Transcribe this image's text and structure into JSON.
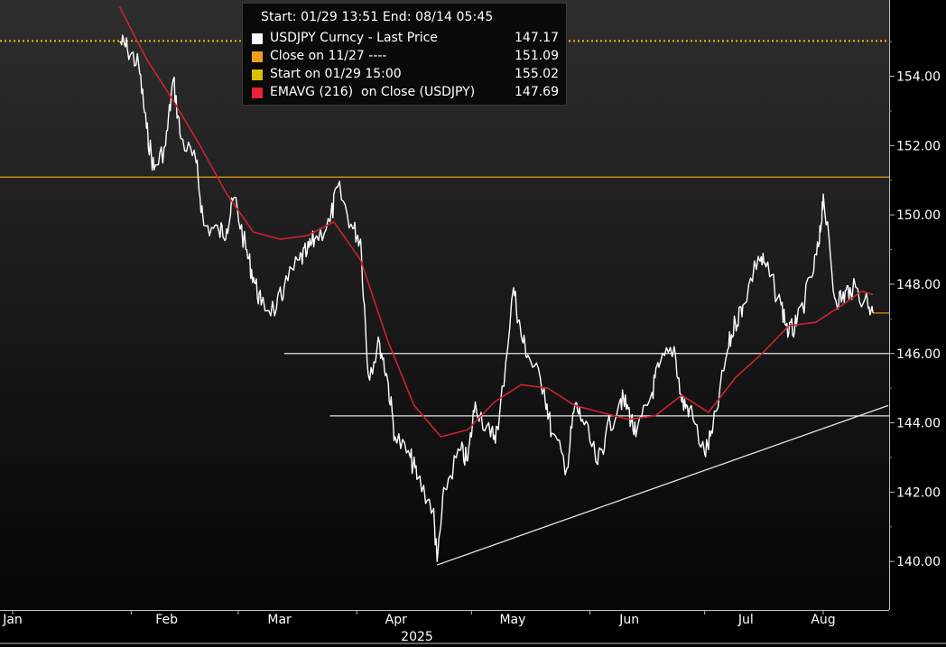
{
  "legend": {
    "header": "Start: 01/29 13:51 End: 08/14 05:45",
    "items": [
      {
        "label": "USDJPY Curncy - Last Price",
        "value": "147.17",
        "color": "#ffffff"
      },
      {
        "label": "Close on 11/27 ----",
        "value": "151.09",
        "color": "#f0a020"
      },
      {
        "label": "Start on 01/29 15:00",
        "value": "155.02",
        "color": "#d8c000"
      },
      {
        "label": "EMAVG (216)  on Close (USDJPY)",
        "value": "147.69",
        "color": "#e8203a"
      }
    ]
  },
  "colors": {
    "background_top": "#2e2e2e",
    "background_bottom": "#050505",
    "price": "#ffffff",
    "ema": "#cc2233",
    "close_line": "#f0a020",
    "start_line": "#e8c000",
    "support_lines": "#e6e6e6"
  },
  "chart_data": {
    "type": "line",
    "title": "",
    "xlabel": "2025",
    "ylabel": "",
    "ylim": [
      138.6,
      156.2
    ],
    "y_ticks": [
      "154.00",
      "152.00",
      "150.00",
      "148.00",
      "146.00",
      "144.00",
      "142.00",
      "140.00"
    ],
    "x_ticks": [
      "Jan",
      "Feb",
      "Mar",
      "Apr",
      "May",
      "Jun",
      "Jul",
      "Aug"
    ],
    "x_range": [
      "2025-01-29",
      "2025-08-18"
    ],
    "grid": false,
    "legend_position": "top-left",
    "series": [
      {
        "name": "USDJPY Curncy - Last Price",
        "dates": [
          "2025-01-29",
          "2025-01-31",
          "2025-02-03",
          "2025-02-05",
          "2025-02-07",
          "2025-02-10",
          "2025-02-12",
          "2025-02-14",
          "2025-02-18",
          "2025-02-20",
          "2025-02-24",
          "2025-02-26",
          "2025-02-28",
          "2025-03-03",
          "2025-03-05",
          "2025-03-07",
          "2025-03-11",
          "2025-03-13",
          "2025-03-17",
          "2025-03-19",
          "2025-03-21",
          "2025-03-25",
          "2025-03-27",
          "2025-03-31",
          "2025-04-02",
          "2025-04-04",
          "2025-04-07",
          "2025-04-09",
          "2025-04-11",
          "2025-04-15",
          "2025-04-17",
          "2025-04-21",
          "2025-04-22",
          "2025-04-24",
          "2025-04-28",
          "2025-04-30",
          "2025-05-02",
          "2025-05-06",
          "2025-05-08",
          "2025-05-12",
          "2025-05-14",
          "2025-05-16",
          "2025-05-20",
          "2025-05-22",
          "2025-05-26",
          "2025-05-28",
          "2025-05-30",
          "2025-06-03",
          "2025-06-05",
          "2025-06-09",
          "2025-06-11",
          "2025-06-13",
          "2025-06-17",
          "2025-06-19",
          "2025-06-23",
          "2025-06-25",
          "2025-06-27",
          "2025-07-01",
          "2025-07-03",
          "2025-07-07",
          "2025-07-09",
          "2025-07-11",
          "2025-07-15",
          "2025-07-17",
          "2025-07-21",
          "2025-07-23",
          "2025-07-25",
          "2025-07-29",
          "2025-07-31",
          "2025-08-01",
          "2025-08-04",
          "2025-08-06",
          "2025-08-08",
          "2025-08-12",
          "2025-08-14"
        ],
        "values": [
          155.0,
          154.8,
          154.3,
          152.5,
          151.3,
          152.0,
          153.9,
          152.2,
          151.5,
          149.7,
          149.5,
          149.6,
          150.5,
          149.0,
          148.2,
          147.4,
          147.3,
          147.9,
          148.7,
          148.9,
          149.3,
          149.8,
          150.8,
          149.6,
          149.3,
          145.4,
          146.3,
          145.3,
          143.6,
          143.0,
          142.4,
          141.5,
          140.0,
          142.1,
          143.2,
          142.9,
          144.6,
          143.6,
          143.8,
          147.9,
          146.5,
          145.9,
          145.0,
          143.7,
          142.7,
          144.5,
          144.1,
          142.8,
          143.6,
          144.7,
          144.4,
          143.6,
          144.8,
          145.6,
          146.2,
          144.6,
          144.4,
          143.1,
          143.7,
          146.1,
          146.9,
          147.4,
          148.8,
          148.5,
          147.4,
          146.6,
          146.8,
          148.2,
          149.2,
          150.6,
          147.6,
          147.6,
          147.9,
          147.6,
          147.17
        ]
      },
      {
        "name": "EMAVG (216)  on Close (USDJPY)",
        "dates": [
          "2025-01-29",
          "2025-02-05",
          "2025-02-12",
          "2025-02-19",
          "2025-02-26",
          "2025-03-05",
          "2025-03-12",
          "2025-03-19",
          "2025-03-26",
          "2025-04-02",
          "2025-04-09",
          "2025-04-16",
          "2025-04-23",
          "2025-04-30",
          "2025-05-07",
          "2025-05-14",
          "2025-05-21",
          "2025-05-28",
          "2025-06-04",
          "2025-06-11",
          "2025-06-18",
          "2025-06-25",
          "2025-07-02",
          "2025-07-09",
          "2025-07-16",
          "2025-07-23",
          "2025-07-30",
          "2025-08-06",
          "2025-08-11",
          "2025-08-14"
        ],
        "values": [
          156.0,
          154.5,
          153.3,
          152.0,
          150.6,
          149.5,
          149.3,
          149.4,
          149.8,
          148.7,
          146.4,
          144.5,
          143.6,
          143.8,
          144.6,
          145.1,
          145.0,
          144.5,
          144.3,
          144.1,
          144.2,
          144.8,
          144.3,
          145.3,
          146.0,
          146.8,
          146.9,
          147.4,
          147.8,
          147.7
        ]
      }
    ],
    "reference_lines": [
      {
        "name": "Close on 11/27",
        "value": 151.09
      },
      {
        "name": "Start on 01/29 15:00",
        "value": 155.02
      },
      {
        "name": "Last Price",
        "value": 147.17
      }
    ],
    "annotations": [
      {
        "type": "horizontal",
        "value": 146.0
      },
      {
        "type": "horizontal",
        "value": 144.2
      },
      {
        "type": "trend",
        "from": [
          "2025-04-22",
          139.9
        ],
        "to": [
          "2025-08-18",
          144.5
        ]
      }
    ]
  }
}
